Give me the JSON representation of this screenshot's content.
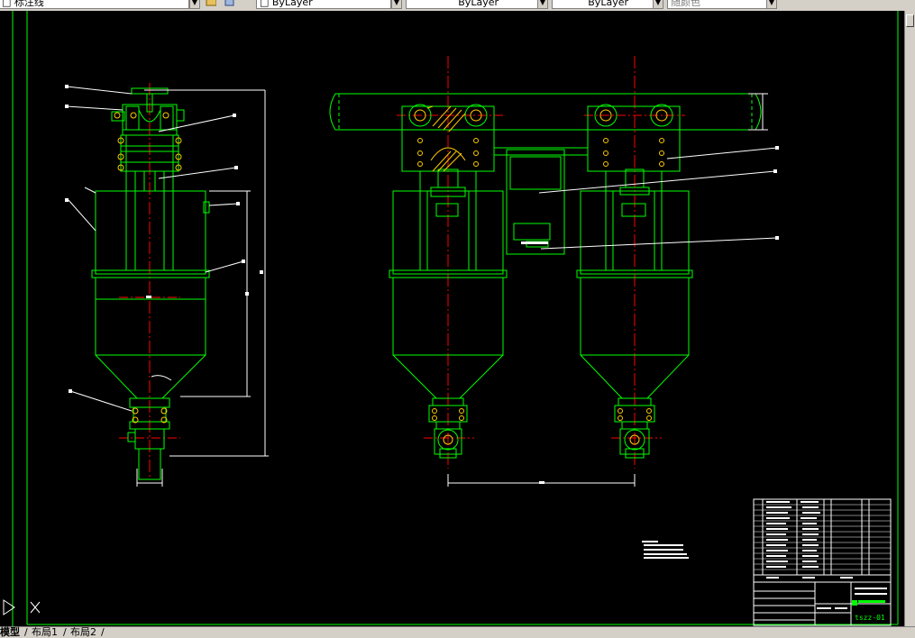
{
  "toolbar": {
    "layer_name": "□ 标注线",
    "color_value": "□ ByLayer",
    "linetype_value": "ByLayer",
    "lineweight_value": "ByLayer",
    "plotstyle_value": "随颜色"
  },
  "drawing": {
    "titleblock_drawing_number": "tszz-01"
  },
  "tabs": {
    "model": "模型",
    "layout1": "布局1",
    "layout2": "布局2"
  },
  "colors": {
    "line": "#00ff00",
    "center": "#ff0000",
    "dim": "#ffffff",
    "hatch": "#ffcc00",
    "background": "#000000",
    "chrome": "#d4d0c8"
  }
}
